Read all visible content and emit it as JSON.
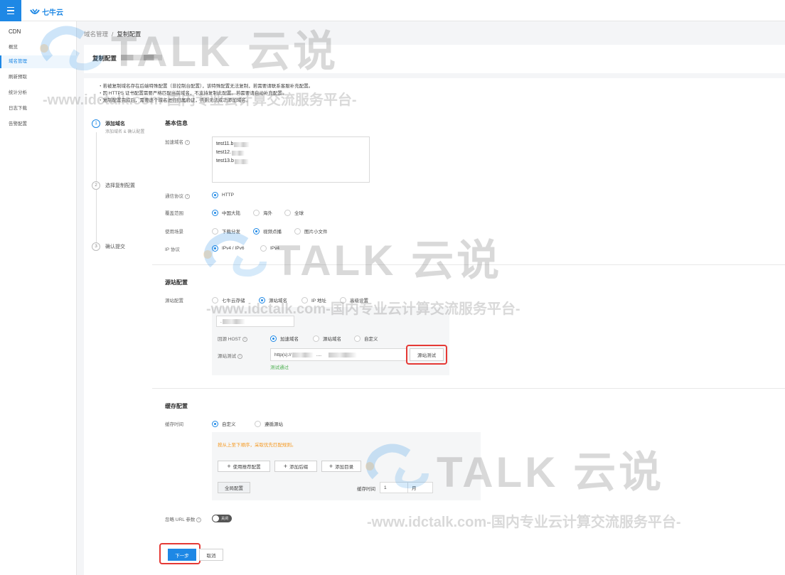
{
  "app": {
    "logo_text": "七牛云"
  },
  "sidebar": {
    "section": "CDN",
    "items": [
      {
        "label": "概览",
        "active": false
      },
      {
        "label": "域名管理",
        "active": true
      },
      {
        "label": "刷新预取",
        "active": false
      },
      {
        "label": "统计分析",
        "active": false
      },
      {
        "label": "日志下载",
        "active": false
      },
      {
        "label": "告警配置",
        "active": false
      }
    ]
  },
  "breadcrumb": {
    "parent": "域名管理",
    "separator": "/",
    "current": "复制配置"
  },
  "page": {
    "title": "复制配置"
  },
  "notes": [
    "・若被复制域名存在后端特殊配置（非控制台配置），该特殊配置无法复制，若需要请联系客服补充配置。",
    "・因 HTTPS 证书配置需要严格匹配当前域名，不支持复制此配置。若需要请自动补充配置。",
    "・复制配置完成后，需要逐个域名进行归属验证，否则无法成功添加域名。"
  ],
  "steps": [
    {
      "num": "1",
      "label": "添加域名",
      "sub": "添加域名 & 确认配置"
    },
    {
      "num": "2",
      "label": "选择复制配置"
    },
    {
      "num": "3",
      "label": "确认提交"
    }
  ],
  "basic": {
    "title": "基本信息",
    "domain_label": "加速域名",
    "domains": [
      "test11.b",
      "test12.",
      "test13.b"
    ],
    "protocol_label": "通信协议",
    "protocol_options": [
      "HTTP"
    ],
    "coverage_label": "覆盖范围",
    "coverage_options": [
      "中国大陆",
      "海外",
      "全球"
    ],
    "scene_label": "使用场景",
    "scene_options": [
      "下载分发",
      "视频点播",
      "图片小文件"
    ],
    "ip_label": "IP 协议",
    "ip_options": [
      "IPv4 / IPv6",
      "IPv4"
    ]
  },
  "origin": {
    "title": "源站配置",
    "config_label": "源站配置",
    "config_options": [
      "七牛云存储",
      "源站域名",
      "IP 地址",
      "高级设置"
    ],
    "origin_value": ".",
    "host_label": "回源 HOST",
    "host_options": [
      "加速域名",
      "源站域名",
      "自定义"
    ],
    "test_label": "源站测试",
    "test_value": "http(s)://",
    "test_suffix": "....",
    "test_button": "源站测试",
    "test_result": "测试通过"
  },
  "cache": {
    "title": "缓存配置",
    "time_label": "缓存时间",
    "time_options": [
      "自定义",
      "遵循源站"
    ],
    "hint": "按从上至下顺序，采取优先匹配规则。",
    "add_recommend": "使用推荐配置",
    "add_suffix": "添加后缀",
    "add_dir": "添加目录",
    "global_button": "全局配置",
    "cache_time_label": "缓存时间",
    "cache_time_value": "1",
    "cache_time_unit": "月"
  },
  "ignore_url": {
    "label": "忽略 URL 参数",
    "toggle_text": "关闭"
  },
  "footer": {
    "next": "下一步",
    "cancel": "取消"
  },
  "watermark": {
    "text": "TALK 云说",
    "url": "-www.idctalk.com-国内专业云计算交流服务平台-"
  },
  "colors": {
    "accent": "#1e88e5",
    "highlight": "#e53935",
    "success": "#4caf50",
    "warning": "#f59a23"
  }
}
